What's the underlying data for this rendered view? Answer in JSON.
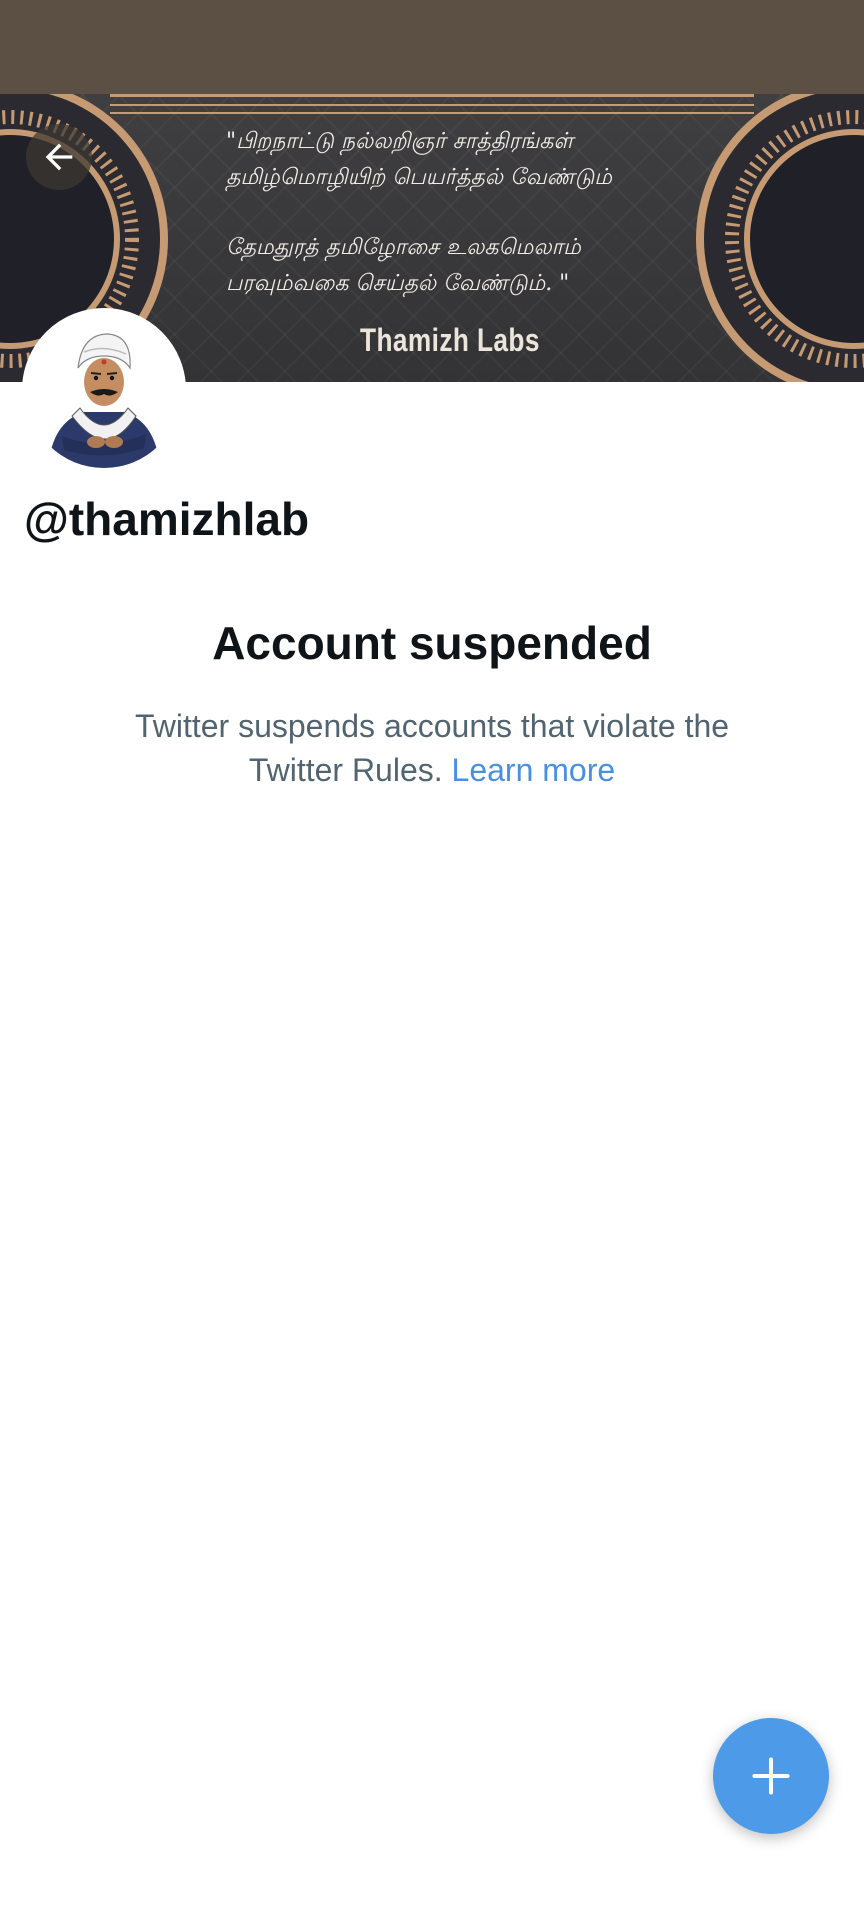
{
  "banner": {
    "quote_line1": "\"பிறநாட்டு நல்லறிஞர் சாத்திரங்கள்",
    "quote_line2": "தமிழ்மொழியிற் பெயர்த்தல் வேண்டும்",
    "quote_line3": "தேமதுரத் தமிழோசை உலகமெலாம்",
    "quote_line4": "பரவும்வகை செய்தல் வேண்டும். \"",
    "brand": "Thamizh Labs",
    "colors": {
      "background": "#3a3a3c",
      "accent": "#c69a72",
      "dark_circle": "#202028"
    }
  },
  "header": {
    "back_icon": "arrow-left-icon"
  },
  "profile": {
    "handle": "@thamizhlab",
    "avatar": "illustrated-portrait"
  },
  "suspension": {
    "title": "Account suspended",
    "message": "Twitter suspends accounts that violate the Twitter Rules.",
    "link_label": "Learn more"
  },
  "fab": {
    "icon": "plus-icon",
    "color": "#4d9be8"
  },
  "colors": {
    "topbar": "#5c5044",
    "link": "#4a90e2",
    "text_primary": "#0f1419",
    "text_secondary": "#536471"
  }
}
